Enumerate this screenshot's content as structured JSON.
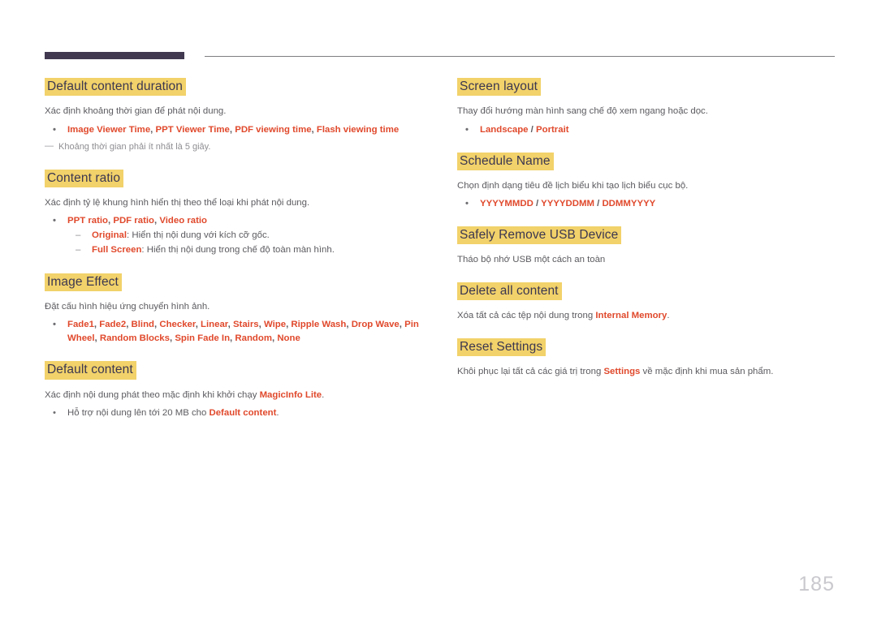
{
  "page": {
    "number": "185",
    "header_bar_color": "#413950",
    "heading_highlight_color": "#f2d26a",
    "heading_text_color": "#3c3750",
    "keyword_color": "#e0492c",
    "body_text_color": "#5b5b60",
    "page_number_color": "#c9c9ce"
  },
  "left_column": [
    {
      "title": "Default content duration",
      "desc": "Xác định khoảng thời gian để phát nội dung.",
      "bullets": [
        {
          "marker": "•",
          "parts": [
            {
              "text": "Image Viewer Time",
              "style": "kw"
            },
            {
              "text": ", ",
              "style": "sep"
            },
            {
              "text": "PPT Viewer Time",
              "style": "kw"
            },
            {
              "text": ", ",
              "style": "sep"
            },
            {
              "text": "PDF viewing time",
              "style": "kw"
            },
            {
              "text": ", ",
              "style": "sep"
            },
            {
              "text": "Flash viewing time",
              "style": "kw"
            }
          ]
        }
      ],
      "note": {
        "marker": "—",
        "text": "Khoảng thời gian phải ít nhất là 5 giây."
      }
    },
    {
      "title": "Content ratio",
      "desc": "Xác định tỷ lệ khung hình hiển thị theo thể loại khi phát nội dung.",
      "bullets": [
        {
          "marker": "•",
          "parts": [
            {
              "text": "PPT ratio",
              "style": "kw"
            },
            {
              "text": ", ",
              "style": "sep"
            },
            {
              "text": "PDF ratio",
              "style": "kw"
            },
            {
              "text": ", ",
              "style": "sep"
            },
            {
              "text": "Video ratio",
              "style": "kw"
            }
          ],
          "sub": [
            {
              "marker": "–",
              "parts": [
                {
                  "text": "Original",
                  "style": "kw"
                },
                {
                  "text": ": Hiển thị nội dung với kích cỡ gốc.",
                  "style": "plain"
                }
              ]
            },
            {
              "marker": "–",
              "parts": [
                {
                  "text": "Full Screen",
                  "style": "kw"
                },
                {
                  "text": ": Hiển thị nội dung trong chế độ toàn màn hình.",
                  "style": "plain"
                }
              ]
            }
          ]
        }
      ]
    },
    {
      "title": "Image Effect",
      "desc": "Đặt cấu hình hiệu ứng chuyển hình ảnh.",
      "bullets": [
        {
          "marker": "•",
          "parts": [
            {
              "text": "Fade1",
              "style": "kw"
            },
            {
              "text": ", ",
              "style": "sep"
            },
            {
              "text": "Fade2",
              "style": "kw"
            },
            {
              "text": ", ",
              "style": "sep"
            },
            {
              "text": "Blind",
              "style": "kw"
            },
            {
              "text": ", ",
              "style": "sep"
            },
            {
              "text": "Checker",
              "style": "kw"
            },
            {
              "text": ", ",
              "style": "sep"
            },
            {
              "text": "Linear",
              "style": "kw"
            },
            {
              "text": ", ",
              "style": "sep"
            },
            {
              "text": "Stairs",
              "style": "kw"
            },
            {
              "text": ", ",
              "style": "sep"
            },
            {
              "text": "Wipe",
              "style": "kw"
            },
            {
              "text": ", ",
              "style": "sep"
            },
            {
              "text": "Ripple Wash",
              "style": "kw"
            },
            {
              "text": ", ",
              "style": "sep"
            },
            {
              "text": "Drop Wave",
              "style": "kw"
            },
            {
              "text": ", ",
              "style": "sep"
            },
            {
              "text": "Pin Wheel",
              "style": "kw"
            },
            {
              "text": ", ",
              "style": "sep"
            },
            {
              "text": "Random Blocks",
              "style": "kw"
            },
            {
              "text": ", ",
              "style": "sep"
            },
            {
              "text": "Spin Fade In",
              "style": "kw"
            },
            {
              "text": ", ",
              "style": "sep"
            },
            {
              "text": "Random",
              "style": "kw"
            },
            {
              "text": ", ",
              "style": "sep"
            },
            {
              "text": "None",
              "style": "kw"
            }
          ]
        }
      ]
    },
    {
      "title": "Default content",
      "desc_parts": [
        {
          "text": "Xác định nội dung phát theo mặc định khi khởi chạy ",
          "style": "plain"
        },
        {
          "text": "MagicInfo Lite",
          "style": "kw"
        },
        {
          "text": ".",
          "style": "plain"
        }
      ],
      "bullets": [
        {
          "marker": "•",
          "plain": true,
          "parts": [
            {
              "text": "Hỗ trợ nội dung lên tới 20 MB cho ",
              "style": "plain"
            },
            {
              "text": "Default content",
              "style": "kw"
            },
            {
              "text": ".",
              "style": "plain"
            }
          ]
        }
      ]
    }
  ],
  "right_column": [
    {
      "title": "Screen layout",
      "desc": "Thay đổi hướng màn hình sang chế độ xem ngang hoặc dọc.",
      "bullets": [
        {
          "marker": "•",
          "parts": [
            {
              "text": "Landscape",
              "style": "kw"
            },
            {
              "text": " / ",
              "style": "sep"
            },
            {
              "text": "Portrait",
              "style": "kw"
            }
          ]
        }
      ]
    },
    {
      "title": "Schedule Name",
      "desc": "Chọn định dạng tiêu đề lịch biểu khi tạo lịch biểu cục bộ.",
      "bullets": [
        {
          "marker": "•",
          "parts": [
            {
              "text": "YYYYMMDD",
              "style": "kw"
            },
            {
              "text": " / ",
              "style": "sep"
            },
            {
              "text": "YYYYDDMM",
              "style": "kw"
            },
            {
              "text": " / ",
              "style": "sep"
            },
            {
              "text": "DDMMYYYY",
              "style": "kw"
            }
          ]
        }
      ]
    },
    {
      "title": "Safely Remove USB Device",
      "desc": "Tháo bộ nhớ USB một cách an toàn",
      "bullets": []
    },
    {
      "title": "Delete all content",
      "desc_parts": [
        {
          "text": "Xóa tất cả các tệp nội dung trong ",
          "style": "plain"
        },
        {
          "text": "Internal Memory",
          "style": "kw"
        },
        {
          "text": ".",
          "style": "plain"
        }
      ],
      "bullets": []
    },
    {
      "title": "Reset Settings",
      "desc_parts": [
        {
          "text": "Khôi phục lại tất cả các giá trị trong ",
          "style": "plain"
        },
        {
          "text": "Settings",
          "style": "kw"
        },
        {
          "text": " về mặc định khi mua sản phẩm.",
          "style": "plain"
        }
      ],
      "bullets": []
    }
  ]
}
